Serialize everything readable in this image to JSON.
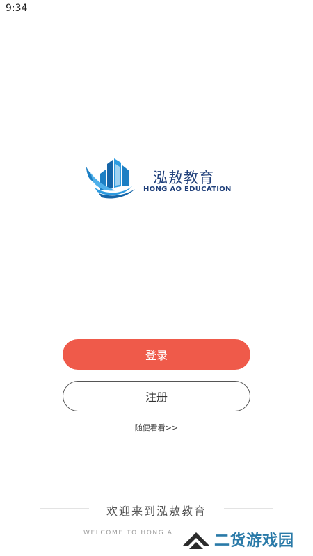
{
  "status_bar": {
    "time": "9:34"
  },
  "logo": {
    "name_cn": "泓敖教育",
    "name_en": "HONG AO EDUCATION"
  },
  "actions": {
    "login_label": "登录",
    "register_label": "注册",
    "browse_label": "随便看看>>"
  },
  "footer": {
    "welcome_cn": "欢迎来到泓敖教育",
    "welcome_en": "WELCOME TO HONG A"
  },
  "watermark": {
    "text": "二货游戏园"
  },
  "colors": {
    "accent": "#ef5a4a",
    "brand": "#1f3f7a",
    "logo_blue": "#1c7fc4",
    "watermark_blue": "#2a7aa8"
  },
  "icons": {
    "logo_mark": "buildings-with-wings-icon",
    "watermark_mark": "chevron-stack-icon"
  }
}
